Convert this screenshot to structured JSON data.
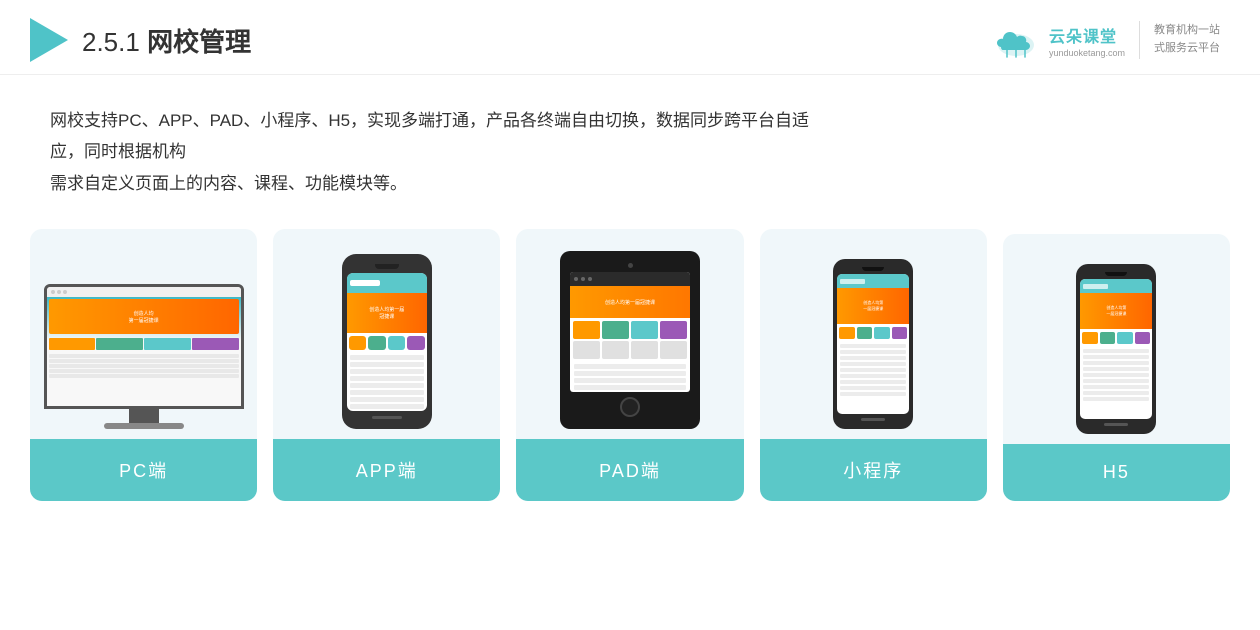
{
  "header": {
    "section_number": "2.5.1",
    "title_plain": " ",
    "title_bold": "网校管理",
    "logo": {
      "brand_cn": "云朵课堂",
      "brand_en": "yunduoketang.com",
      "slogan_line1": "教育机构一站",
      "slogan_line2": "式服务云平台"
    }
  },
  "description": {
    "line1": "网校支持PC、APP、PAD、小程序、H5，实现多端打通，产品各终端自由切换，数据同步跨平台自适应，同时根据机构",
    "line2": "需求自定义页面上的内容、课程、功能模块等。"
  },
  "cards": [
    {
      "id": "pc",
      "label": "PC端",
      "device_type": "monitor"
    },
    {
      "id": "app",
      "label": "APP端",
      "device_type": "phone"
    },
    {
      "id": "pad",
      "label": "PAD端",
      "device_type": "pad"
    },
    {
      "id": "miniprogram",
      "label": "小程序",
      "device_type": "small-phone"
    },
    {
      "id": "h5",
      "label": "H5",
      "device_type": "small-phone"
    }
  ]
}
